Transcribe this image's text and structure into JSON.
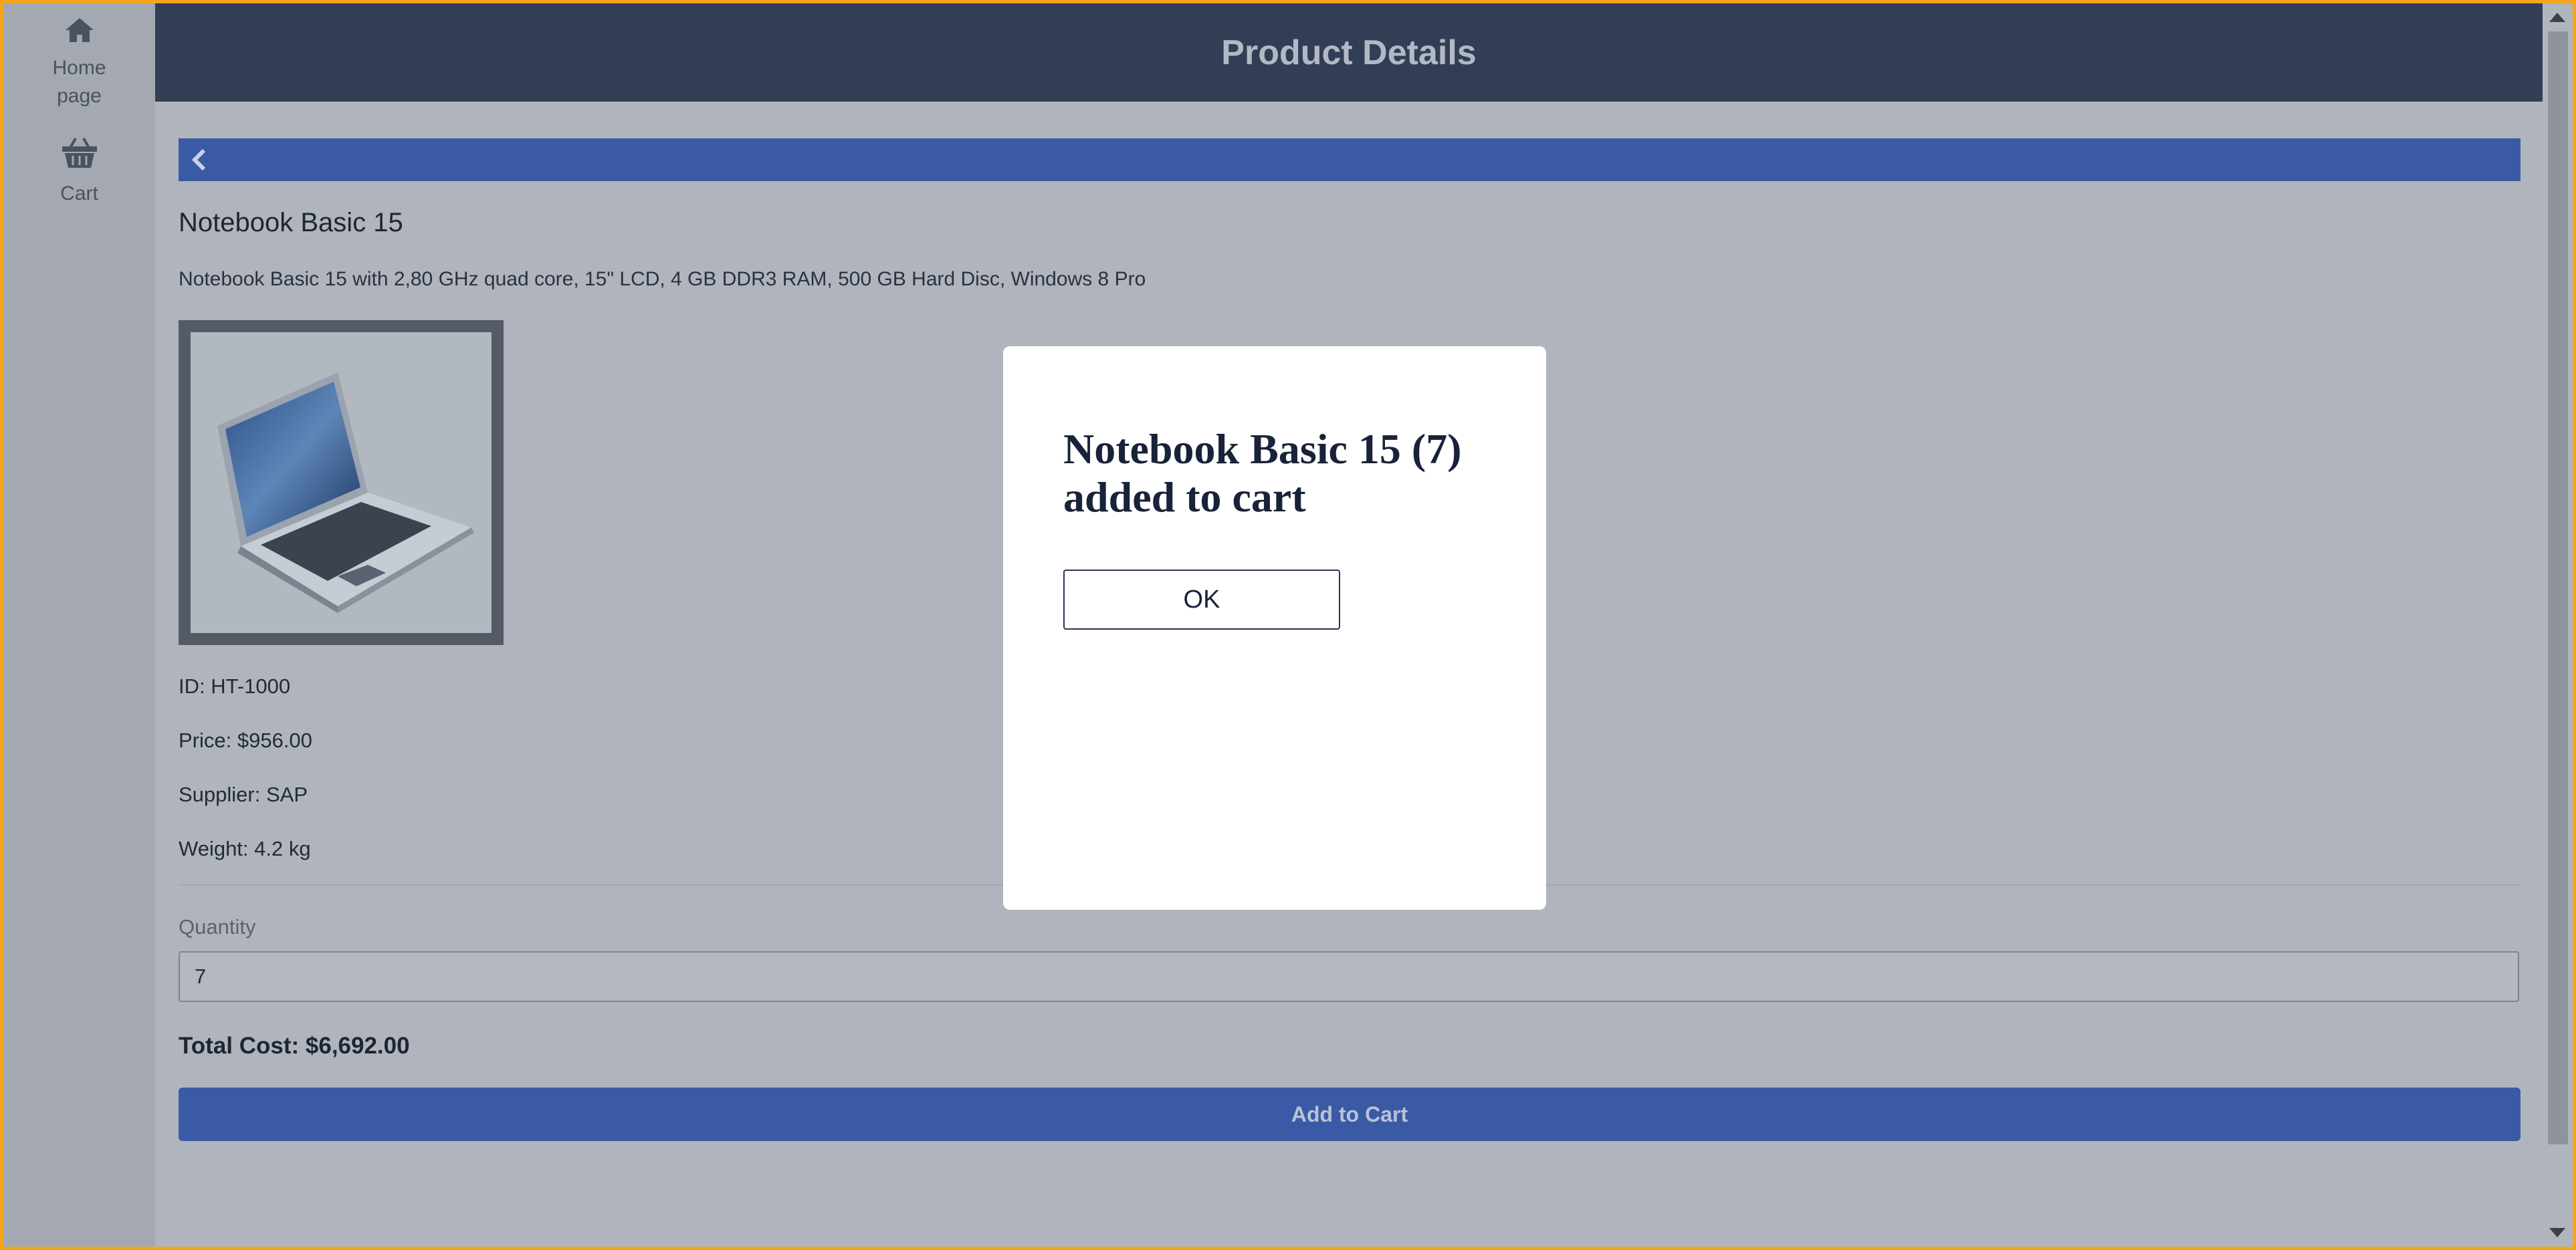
{
  "sidebar": {
    "items": [
      {
        "label": "Home page",
        "icon": "home-icon"
      },
      {
        "label": "Cart",
        "icon": "basket-icon"
      }
    ]
  },
  "header": {
    "title": "Product Details"
  },
  "back": {
    "icon": "chevron-left-icon"
  },
  "product": {
    "title": "Notebook Basic 15",
    "description": "Notebook Basic 15 with 2,80 GHz quad core, 15\" LCD, 4 GB DDR3 RAM, 500 GB Hard Disc, Windows 8 Pro",
    "id_text": "ID: HT-1000",
    "price_text": "Price: $956.00",
    "supplier_text": "Supplier: SAP",
    "weight_text": "Weight: 4.2 kg"
  },
  "quantity": {
    "label": "Quantity",
    "value": "7"
  },
  "total": {
    "text": "Total Cost: $6,692.00"
  },
  "add_button": {
    "label": "Add to Cart"
  },
  "dialog": {
    "message": "Notebook Basic 15 (7) added to cart",
    "ok_label": "OK"
  },
  "colors": {
    "header_bg": "#313e55",
    "accent": "#3a5aa5",
    "frame_border": "#f3a51b",
    "overlay_bg": "#b0b5bd"
  }
}
